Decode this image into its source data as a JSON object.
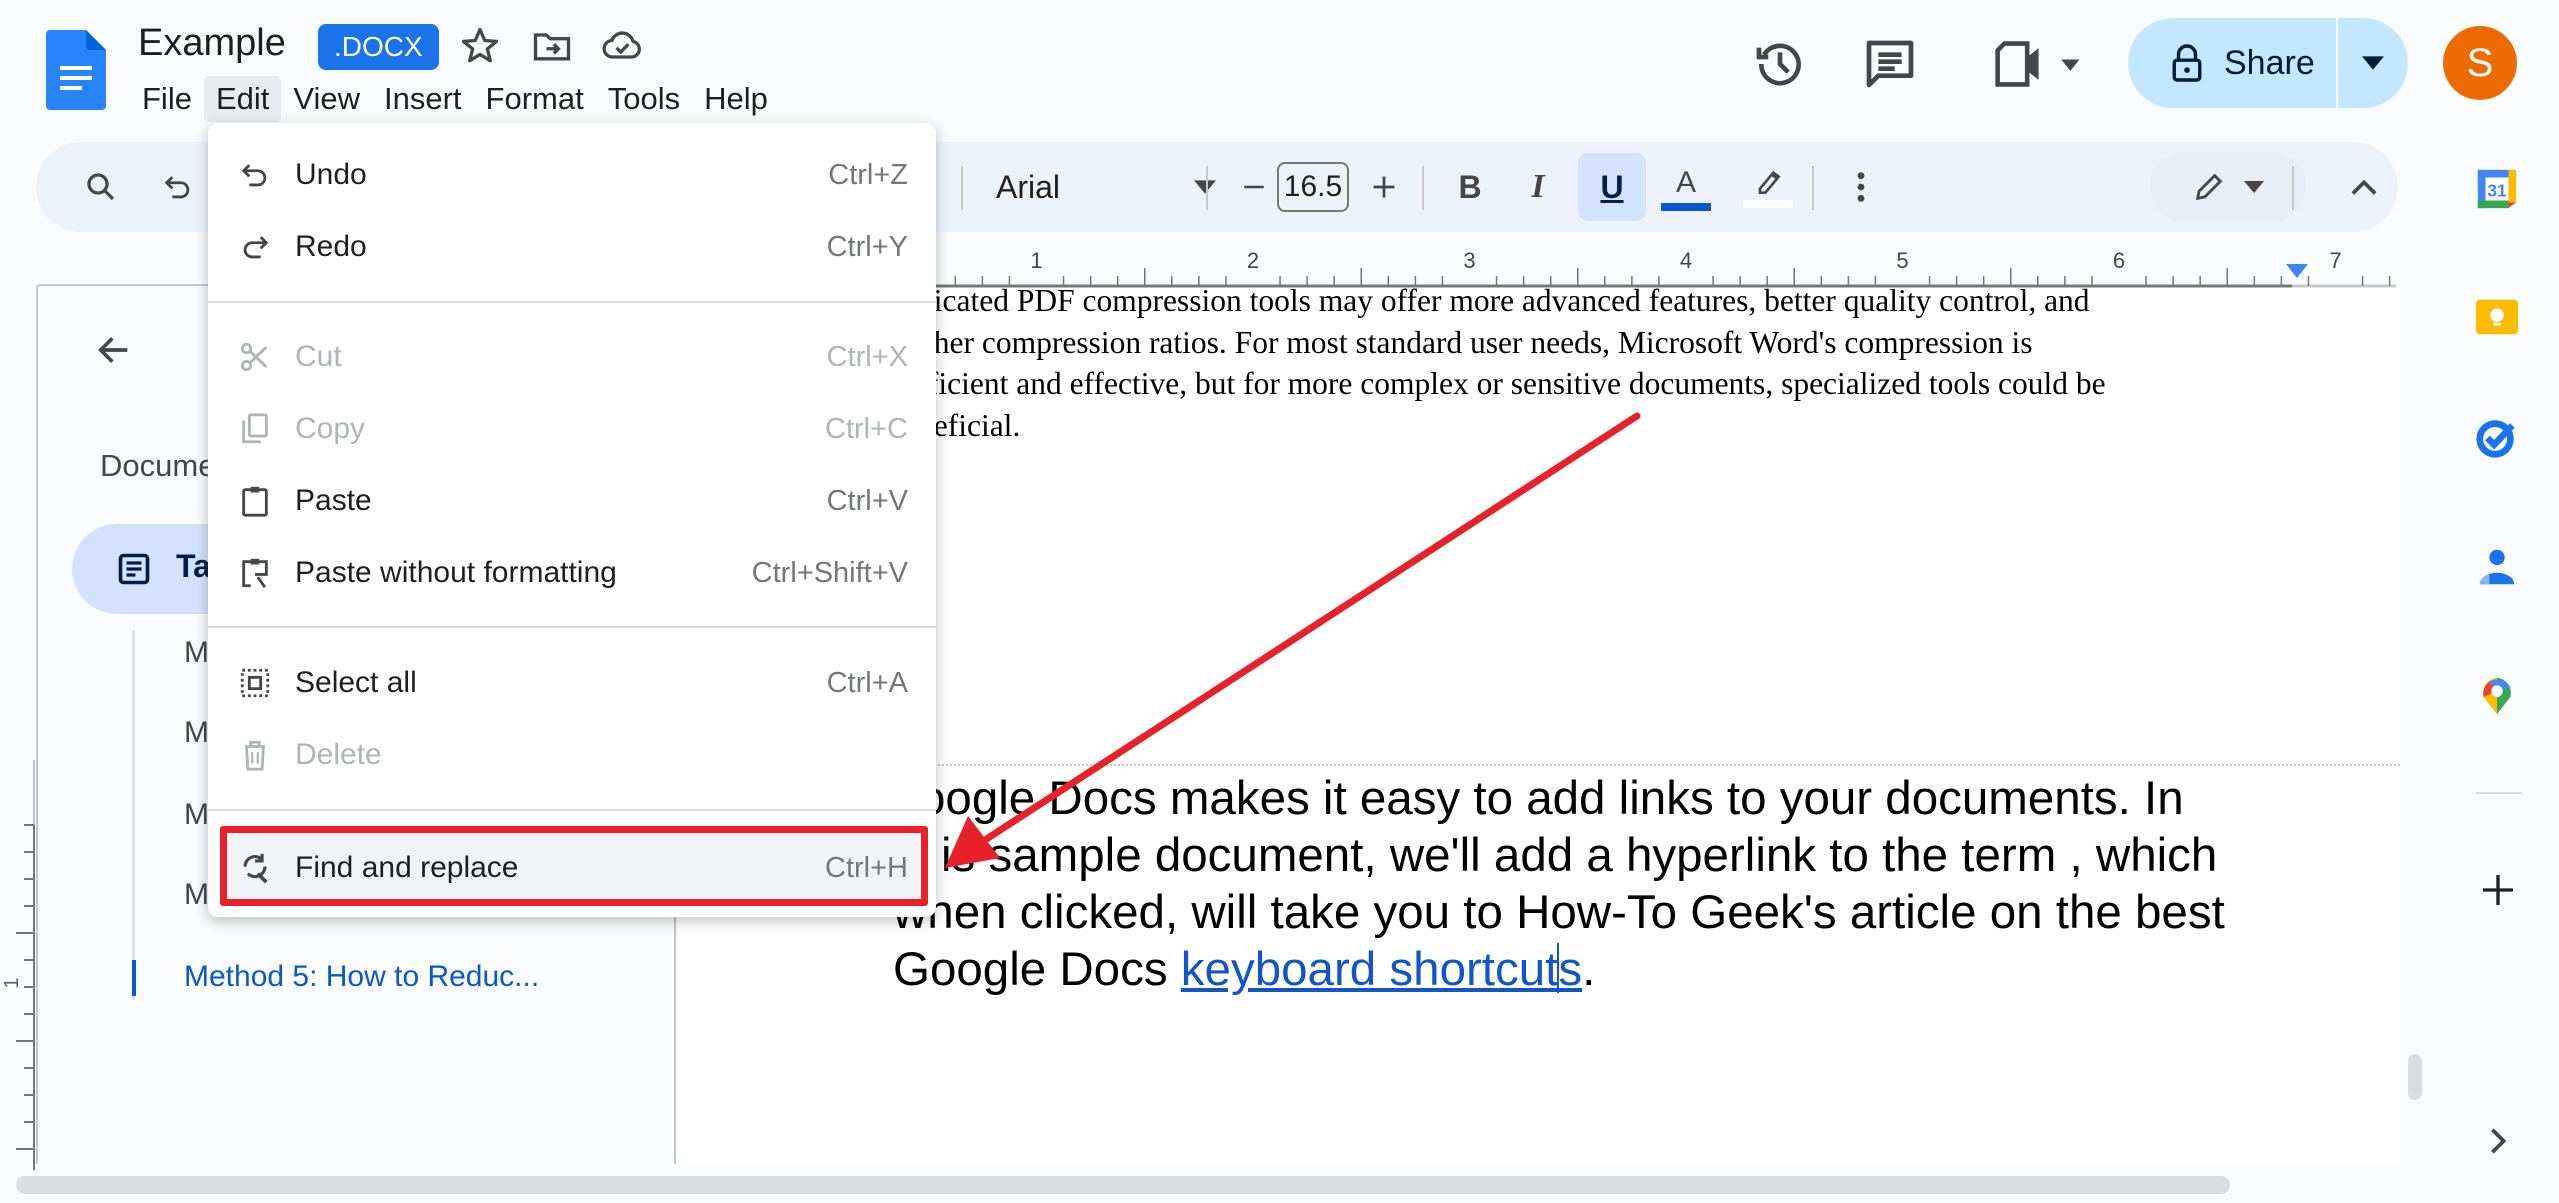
{
  "header": {
    "doc_title": "Example",
    "file_badge": ".DOCX",
    "menus": [
      "File",
      "Edit",
      "View",
      "Insert",
      "Format",
      "Tools",
      "Help"
    ],
    "active_menu": "Edit",
    "share_label": "Share",
    "avatar_initial": "S",
    "icons": [
      "star-icon",
      "move-to-folder-icon",
      "cloud-saved-icon",
      "version-history-icon",
      "comments-icon",
      "meet-icon",
      "lock-icon"
    ]
  },
  "toolbar": {
    "font_name": "Arial",
    "font_size": "16.5",
    "text_color": "#0b57d0",
    "highlight_color": "#ffffff",
    "underline_active": true
  },
  "edit_menu": {
    "items": [
      {
        "label": "Undo",
        "shortcut": "Ctrl+Z",
        "icon": "undo-icon",
        "enabled": true
      },
      {
        "label": "Redo",
        "shortcut": "Ctrl+Y",
        "icon": "redo-icon",
        "enabled": true
      },
      {
        "label": "Cut",
        "shortcut": "Ctrl+X",
        "icon": "cut-icon",
        "enabled": false
      },
      {
        "label": "Copy",
        "shortcut": "Ctrl+C",
        "icon": "copy-icon",
        "enabled": false
      },
      {
        "label": "Paste",
        "shortcut": "Ctrl+V",
        "icon": "paste-icon",
        "enabled": true
      },
      {
        "label": "Paste without formatting",
        "shortcut": "Ctrl+Shift+V",
        "icon": "paste-plain-icon",
        "enabled": true
      },
      {
        "label": "Select all",
        "shortcut": "Ctrl+A",
        "icon": "select-all-icon",
        "enabled": true
      },
      {
        "label": "Delete",
        "shortcut": "",
        "icon": "delete-icon",
        "enabled": false
      },
      {
        "label": "Find and replace",
        "shortcut": "Ctrl+H",
        "icon": "find-replace-icon",
        "enabled": true,
        "highlighted": true
      }
    ]
  },
  "outline": {
    "heading": "Docume",
    "tab_label": "Ta",
    "items": [
      "M",
      "M",
      "M",
      "M",
      "Method 5: How to Reduc..."
    ]
  },
  "ruler": {
    "h_labels": [
      "1",
      "2",
      "3",
      "4",
      "5",
      "6",
      "7"
    ],
    "v_labels": [
      "1"
    ]
  },
  "document": {
    "para1_lines": [
      "dicated PDF compression tools may offer more advanced features, better quality control, and",
      "gher compression ratios. For most standard user needs, Microsoft Word's compression is",
      "fficient and effective, but for more complex or sensitive documents, specialized tools could be",
      "neficial."
    ],
    "para2_lines": [
      "oogle Docs makes it easy to add links to your documents. In",
      "is sample document, we'll add a hyperlink to the term , which",
      "when clicked, will take you to How-To Geek's article on the best"
    ],
    "para2_last_prefix": "Google Docs ",
    "link_text_a": "keyboard shortcut",
    "link_text_b": "s",
    "para2_last_suffix": "."
  },
  "side_panel": {
    "apps": [
      "calendar-icon",
      "keep-icon",
      "tasks-icon",
      "contacts-icon",
      "maps-icon"
    ],
    "calendar_day": "31"
  },
  "annotation": {
    "color": "#e8202a",
    "target": "Find and replace"
  }
}
